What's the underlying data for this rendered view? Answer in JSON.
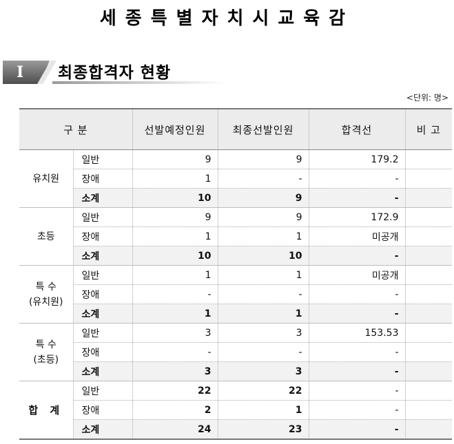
{
  "org_title": "세종특별자치시교육감",
  "section": {
    "roman": "I",
    "title": "최종합격자 현황"
  },
  "unit_label": "<단위: 명>",
  "table": {
    "headers": {
      "category": "구  분",
      "planned": "선발예정인원",
      "final": "최종선발인원",
      "cutoff": "합격선",
      "remarks": "비 고"
    },
    "groups": [
      {
        "name_line1": "유치원",
        "name_line2": "",
        "rows": [
          {
            "type": "일반",
            "planned": "9",
            "final": "9",
            "cutoff": "179.2",
            "remarks": ""
          },
          {
            "type": "장애",
            "planned": "1",
            "final": "-",
            "cutoff": "-",
            "remarks": ""
          },
          {
            "type": "소계",
            "planned": "10",
            "final": "9",
            "cutoff": "-",
            "remarks": ""
          }
        ]
      },
      {
        "name_line1": "초등",
        "name_line2": "",
        "rows": [
          {
            "type": "일반",
            "planned": "9",
            "final": "9",
            "cutoff": "172.9",
            "remarks": ""
          },
          {
            "type": "장애",
            "planned": "1",
            "final": "1",
            "cutoff": "미공개",
            "remarks": ""
          },
          {
            "type": "소계",
            "planned": "10",
            "final": "10",
            "cutoff": "-",
            "remarks": ""
          }
        ]
      },
      {
        "name_line1": "특  수",
        "name_line2": "(유치원)",
        "rows": [
          {
            "type": "일반",
            "planned": "1",
            "final": "1",
            "cutoff": "미공개",
            "remarks": ""
          },
          {
            "type": "장애",
            "planned": "-",
            "final": "-",
            "cutoff": "-",
            "remarks": ""
          },
          {
            "type": "소계",
            "planned": "1",
            "final": "1",
            "cutoff": "-",
            "remarks": ""
          }
        ]
      },
      {
        "name_line1": "특  수",
        "name_line2": "(초등)",
        "rows": [
          {
            "type": "일반",
            "planned": "3",
            "final": "3",
            "cutoff": "153.53",
            "remarks": ""
          },
          {
            "type": "장애",
            "planned": "-",
            "final": "-",
            "cutoff": "-",
            "remarks": ""
          },
          {
            "type": "소계",
            "planned": "3",
            "final": "3",
            "cutoff": "-",
            "remarks": ""
          }
        ]
      },
      {
        "name_line1": "합 계",
        "name_line2": "",
        "total": true,
        "rows": [
          {
            "type": "일반",
            "planned": "22",
            "final": "22",
            "cutoff": "-",
            "remarks": ""
          },
          {
            "type": "장애",
            "planned": "2",
            "final": "1",
            "cutoff": "-",
            "remarks": ""
          },
          {
            "type": "소계",
            "planned": "24",
            "final": "23",
            "cutoff": "-",
            "remarks": ""
          }
        ]
      }
    ]
  }
}
